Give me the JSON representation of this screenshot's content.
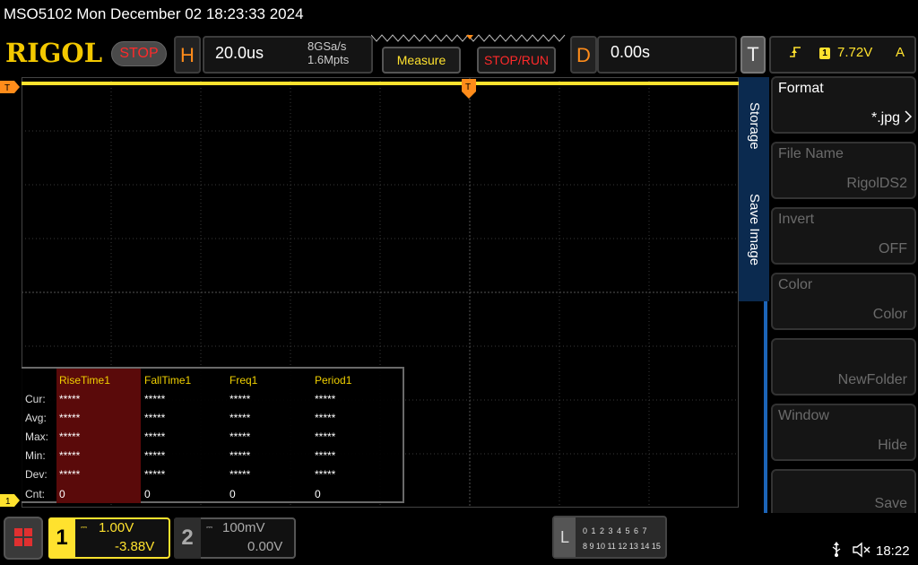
{
  "title_bar": {
    "text": "MSO5102  Mon December 02 18:23:33 2024"
  },
  "brand": {
    "logo": "RIGOL",
    "run_state": "STOP"
  },
  "horizontal": {
    "letter": "H",
    "timebase": "20.0us",
    "sample_rate": "8GSa/s",
    "memory_depth": "1.6Mpts"
  },
  "buttons": {
    "measure": "Measure",
    "stop_run": "STOP/RUN"
  },
  "delay": {
    "letter": "D",
    "value": "0.00s"
  },
  "trigger": {
    "letter": "T",
    "source": "1",
    "level": "7.72V",
    "mode": "A",
    "edge_icon": "rising-edge-icon"
  },
  "markers": {
    "trigger_level": "T",
    "channel1": "1",
    "trigger_pos": "T"
  },
  "measurements": {
    "headers": [
      "RiseTime1",
      "FallTime1",
      "Freq1",
      "Period1"
    ],
    "rows": [
      {
        "label": "Cur:",
        "values": [
          "*****",
          "*****",
          "*****",
          "*****"
        ]
      },
      {
        "label": "Avg:",
        "values": [
          "*****",
          "*****",
          "*****",
          "*****"
        ]
      },
      {
        "label": "Max:",
        "values": [
          "*****",
          "*****",
          "*****",
          "*****"
        ]
      },
      {
        "label": "Min:",
        "values": [
          "*****",
          "*****",
          "*****",
          "*****"
        ]
      },
      {
        "label": "Dev:",
        "values": [
          "*****",
          "*****",
          "*****",
          "*****"
        ]
      },
      {
        "label": "Cnt:",
        "values": [
          "0",
          "0",
          "0",
          "0"
        ]
      }
    ]
  },
  "side_menu": {
    "tab_top": "Storage",
    "tab_bottom": "Save Image",
    "items": [
      {
        "title": "Format",
        "value": "*.jpg"
      },
      {
        "title": "File Name",
        "value": "RigolDS2"
      },
      {
        "title": "Invert",
        "value": "OFF"
      },
      {
        "title": "Color",
        "value": "Color"
      },
      {
        "title": "",
        "value": "NewFolder"
      },
      {
        "title": "Window",
        "value": "Hide"
      },
      {
        "title": "",
        "value": "Save"
      }
    ]
  },
  "channels": {
    "ch1": {
      "number": "1",
      "scale": "1.00V",
      "offset": "-3.88V",
      "color": "#ffe22e"
    },
    "ch2": {
      "number": "2",
      "scale": "100mV",
      "offset": "0.00V",
      "color": "#aaaaaa"
    }
  },
  "logic_analyzer": {
    "letter": "L",
    "row1": "0 1 2 3  4 5 6 7",
    "row2": "8 9 10 11 12 13 14 15"
  },
  "status": {
    "time": "18:22",
    "usb_icon": "usb-icon",
    "sound_icon": "mute-icon"
  },
  "colors": {
    "ch1": "#ffe22e",
    "accent_orange": "#ff8c1a",
    "menu_blue": "#1c64b8",
    "stop_red": "#ff2a2a"
  }
}
